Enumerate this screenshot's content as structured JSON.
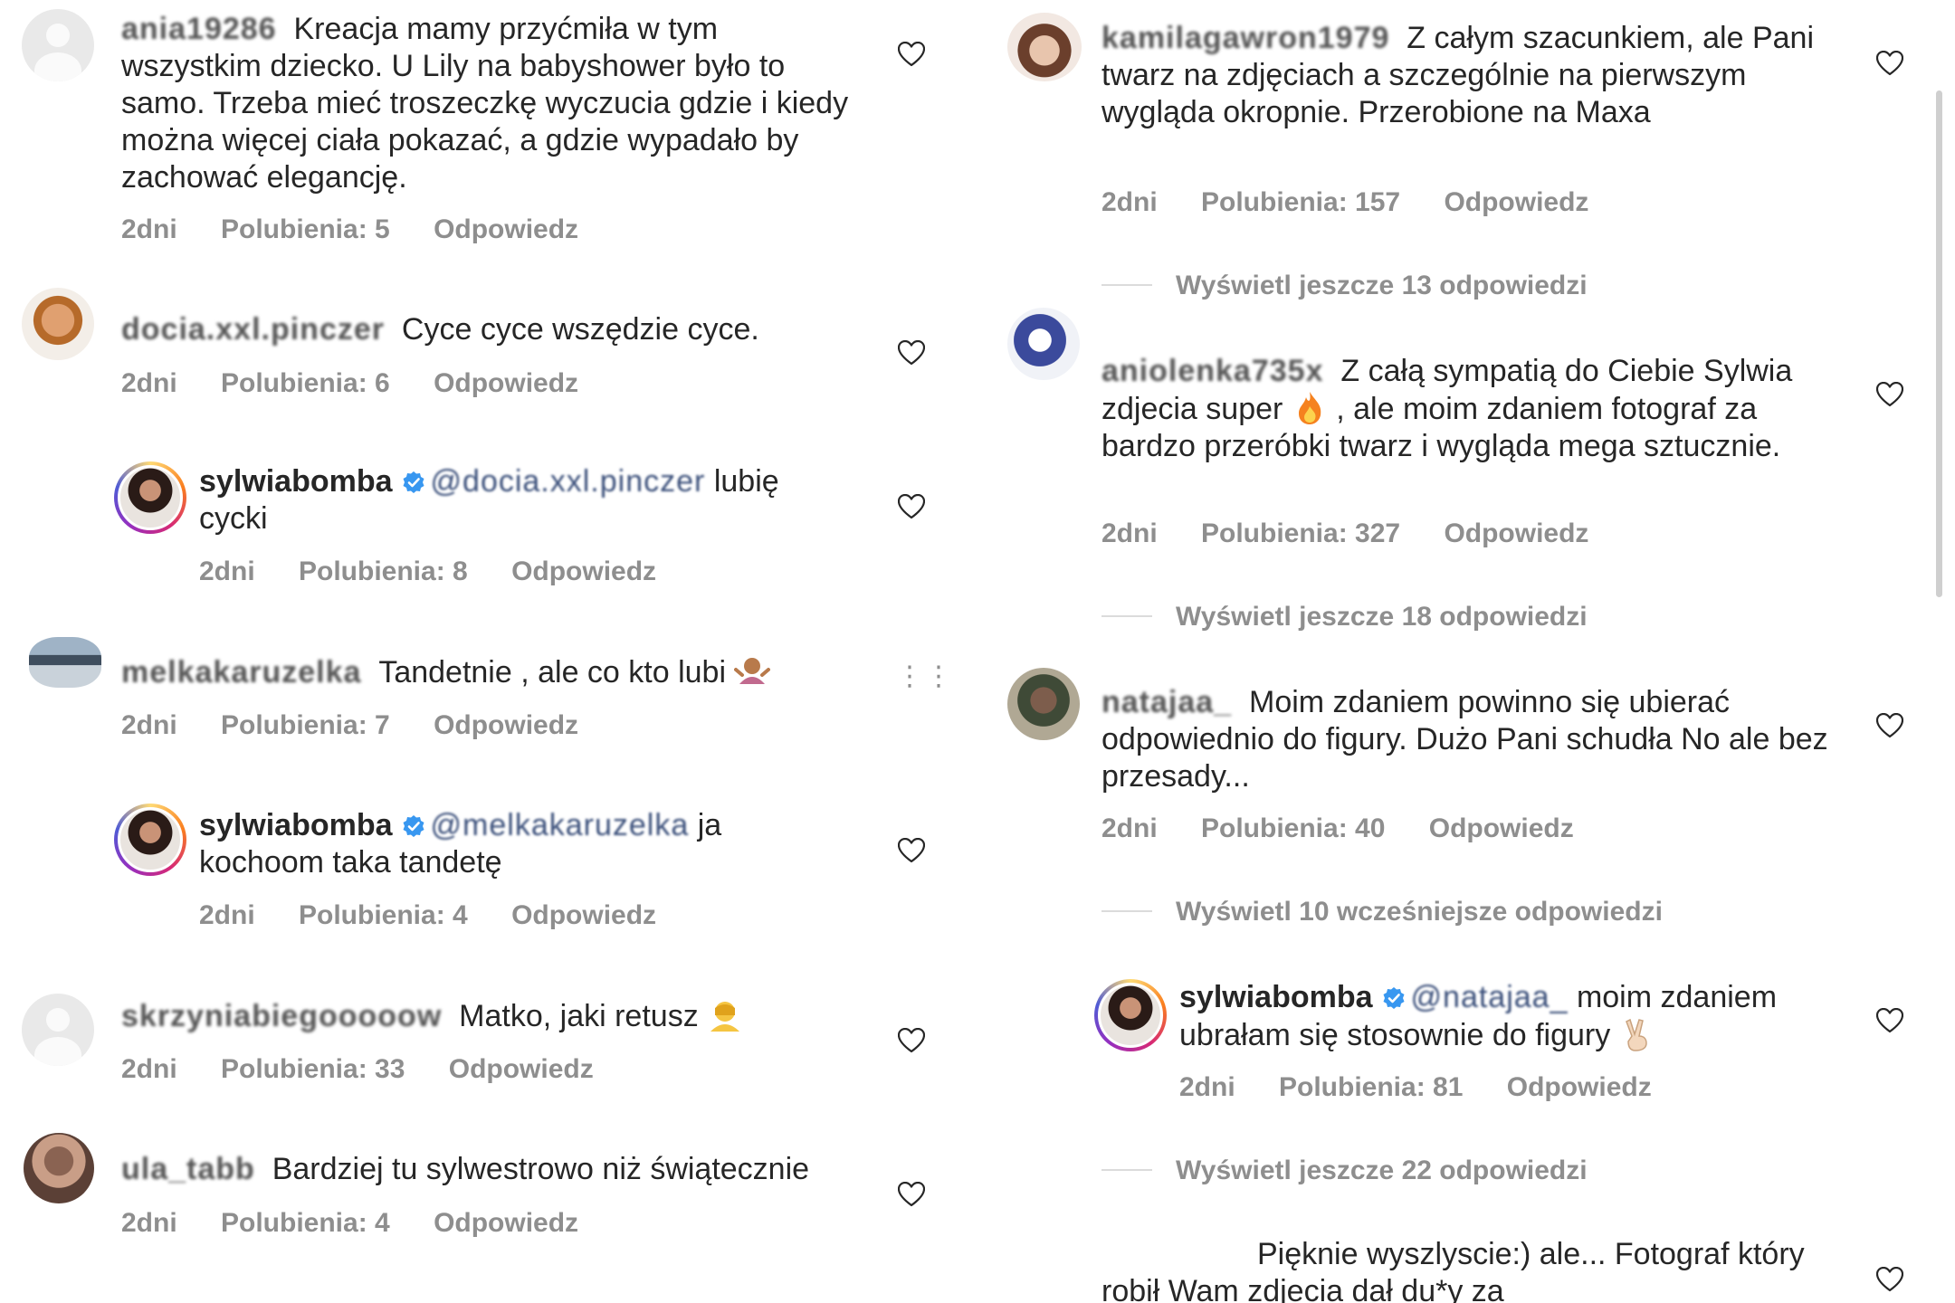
{
  "left_column": {
    "comments": [
      {
        "username": "ania19286",
        "text": "Kreacja mamy przyćmiła w tym wszystkim dziecko. U Lily na babyshower było to samo. Trzeba mieć troszeczkę wyczucia gdzie i kiedy można więcej ciała pokazać, a gdzie wypadało by zachować elegancję.",
        "time": "2dni",
        "likes": "Polubienia: 5",
        "reply": "Odpowiedz"
      },
      {
        "username": "docia.xxl.pinczer",
        "text": "Cyce cyce wszędzie cyce.",
        "time": "2dni",
        "likes": "Polubienia: 6",
        "reply": "Odpowiedz"
      },
      {
        "username": "sylwiabomba",
        "mention": "@docia.xxl.pinczer",
        "text": "lubię cycki",
        "time": "2dni",
        "likes": "Polubienia: 8",
        "reply": "Odpowiedz"
      },
      {
        "username": "melkakaruzelka",
        "text": "Tandetnie , ale co kto lubi",
        "time": "2dni",
        "likes": "Polubienia: 7",
        "reply": "Odpowiedz"
      },
      {
        "username": "sylwiabomba",
        "mention": "@melkakaruzelka",
        "text": "ja kochoom taka tandetę",
        "time": "2dni",
        "likes": "Polubienia: 4",
        "reply": "Odpowiedz"
      },
      {
        "username": "skrzyniabiegooooow",
        "text": "Matko, jaki retusz",
        "time": "2dni",
        "likes": "Polubienia: 33",
        "reply": "Odpowiedz"
      },
      {
        "username": "ula_tabb",
        "text": "Bardziej tu sylwestrowo niż świątecznie",
        "time": "2dni",
        "likes": "Polubienia: 4",
        "reply": "Odpowiedz"
      }
    ]
  },
  "right_column": {
    "comments": [
      {
        "username": "kamilagawron1979",
        "text": "Z całym szacunkiem, ale Pani twarz na zdjęciach a szczególnie na pierwszym wygląda okropnie. Przerobione na Maxa",
        "time": "2dni",
        "likes": "Polubienia: 157",
        "reply": "Odpowiedz"
      },
      {
        "username": "aniolenka735x",
        "text_before": "Z całą sympatią do Ciebie Sylwia zdjecia super",
        "text_after": ", ale moim zdaniem fotograf za bardzo przeróbki twarz i wygląda mega sztucznie.",
        "time": "2dni",
        "likes": "Polubienia: 327",
        "reply": "Odpowiedz"
      },
      {
        "username": "natajaa_",
        "text": "Moim zdaniem powinno się ubierać odpowiednio do figury. Dużo Pani schudła No ale bez przesady...",
        "time": "2dni",
        "likes": "Polubienia: 40",
        "reply": "Odpowiedz"
      },
      {
        "username": "sylwiabomba",
        "mention": "@natajaa_",
        "text": "moim zdaniem ubrałam się stosownie do figury",
        "time": "2dni",
        "likes": "Polubienia: 81",
        "reply": "Odpowiedz"
      },
      {
        "text": "Pięknie wyszlyscie:) ale... Fotograf który robił Wam zdjecia dał du*y za"
      }
    ],
    "view_more": [
      "Wyświetl jeszcze 13 odpowiedzi",
      "Wyświetl jeszcze 18 odpowiedzi",
      "Wyświetl 10 wcześniejsze odpowiedzi",
      "Wyświetl jeszcze 22 odpowiedzi"
    ]
  },
  "colors": {
    "text": "#262626",
    "meta": "#8e8e8e",
    "verified": "#3897f0",
    "background": "#ffffff"
  },
  "icons": [
    "heart-outline-icon",
    "verified-badge-icon",
    "more-options-icon"
  ]
}
